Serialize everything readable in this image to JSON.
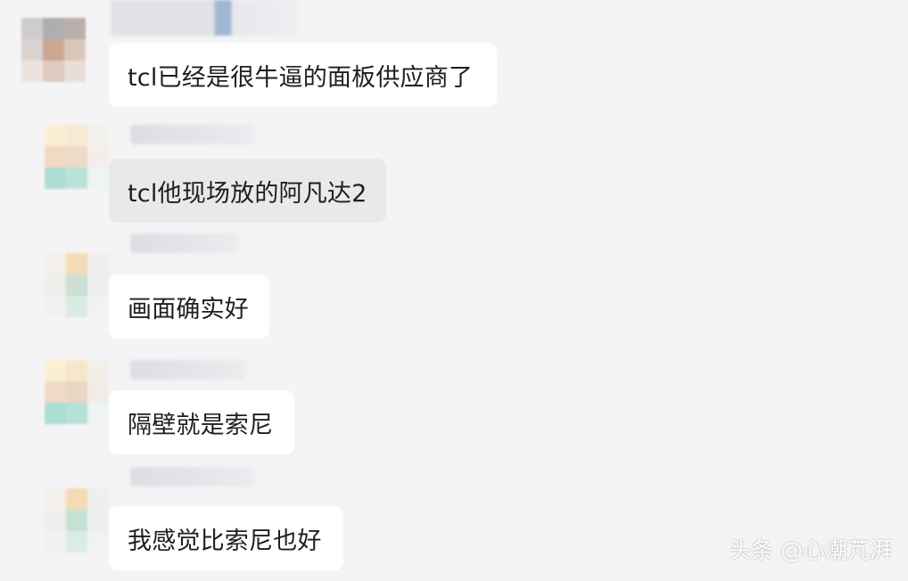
{
  "messages": [
    {
      "text": "tcl已经是很牛逼的面板供应商了",
      "bubble_color": "#ffffff"
    },
    {
      "text": "tcl他现场放的阿凡达2",
      "bubble_color": "#e9e9ec"
    },
    {
      "text": "画面确实好",
      "bubble_color": "#ffffff"
    },
    {
      "text": "隔壁就是索尼",
      "bubble_color": "#ffffff"
    },
    {
      "text": "我感觉比索尼也好",
      "bubble_color": "#ffffff"
    }
  ],
  "watermark": "头条 @心潮芃湃",
  "colors": {
    "background": "#f4f4f6",
    "text": "#1e1e1e"
  }
}
